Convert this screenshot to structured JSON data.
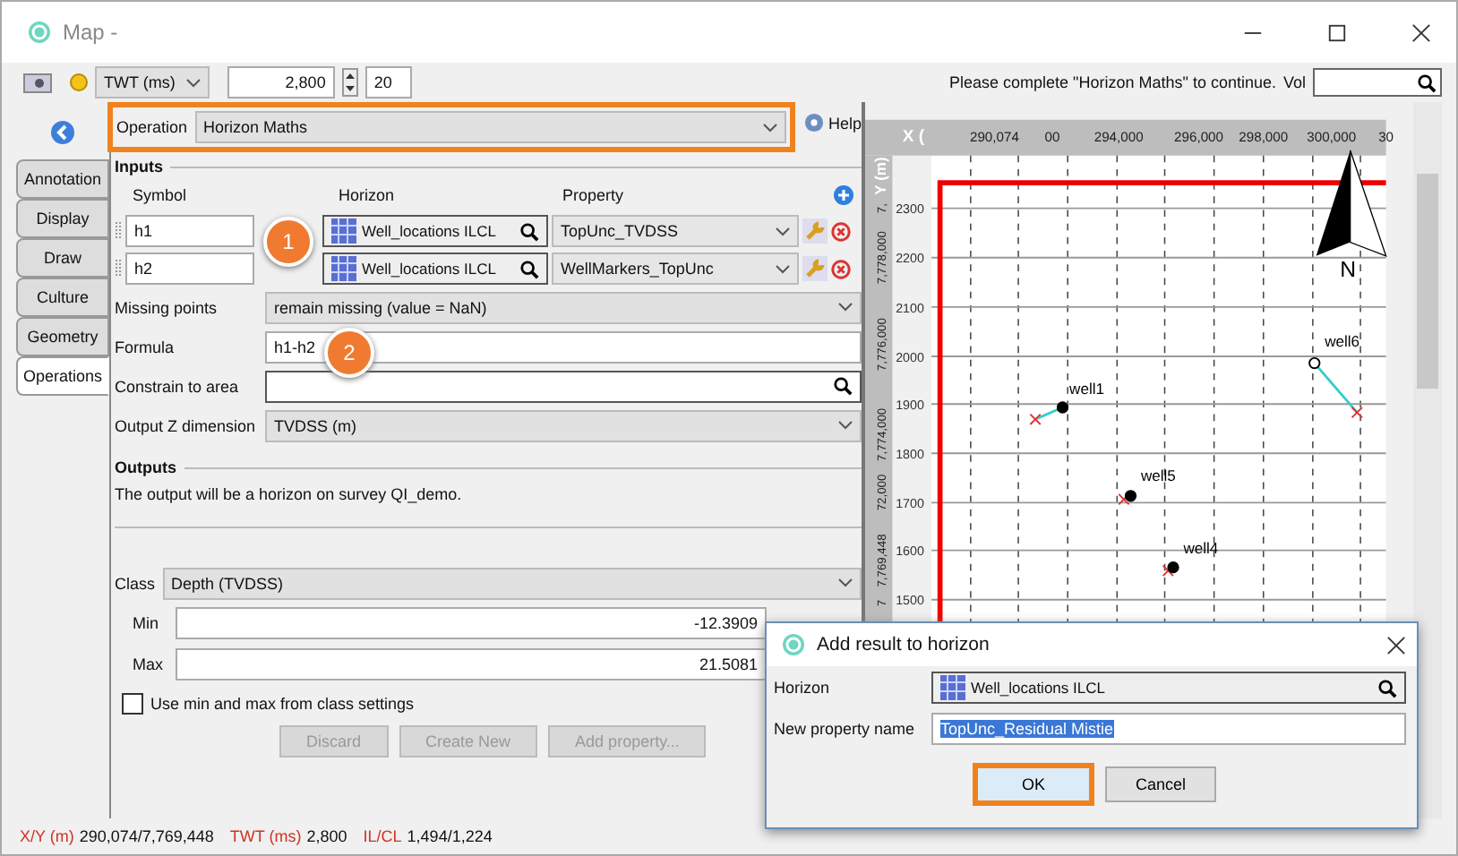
{
  "window": {
    "title": "Map -"
  },
  "toolbar": {
    "domain": "TWT (ms)",
    "value": "2,800",
    "step": "20",
    "message": "Please complete \"Horizon Maths\" to continue.",
    "vol_label": "Vol"
  },
  "side_tabs": [
    {
      "label": "Annotation",
      "selected": false
    },
    {
      "label": "Display",
      "selected": false
    },
    {
      "label": "Draw",
      "selected": false
    },
    {
      "label": "Culture",
      "selected": false
    },
    {
      "label": "Geometry",
      "selected": false
    },
    {
      "label": "Operations",
      "selected": true
    }
  ],
  "operation": {
    "label": "Operation",
    "value": "Horizon Maths",
    "help": "Help",
    "highlighted": true
  },
  "inputs": {
    "title": "Inputs",
    "headers": [
      "Symbol",
      "Horizon",
      "Property"
    ],
    "rows": [
      {
        "symbol": "h1",
        "horizon": "Well_locations ILCL",
        "property": "TopUnc_TVDSS"
      },
      {
        "symbol": "h2",
        "horizon": "Well_locations ILCL",
        "property": "WellMarkers_TopUnc"
      }
    ]
  },
  "fields": [
    {
      "label": "Missing points",
      "value": "remain missing (value = NaN)",
      "kind": "dropdown"
    },
    {
      "label": "Formula",
      "value": "h1-h2",
      "kind": "text"
    },
    {
      "label": "Constrain to area",
      "kind": "search"
    },
    {
      "label": "Output Z dimension",
      "value": "TVDSS (m)",
      "kind": "dropdown"
    }
  ],
  "outputs": {
    "title": "Outputs",
    "text": "The output will be a horizon on survey QI_demo."
  },
  "class": {
    "label": "Class",
    "value": "Depth (TVDSS)",
    "min_label": "Min",
    "min": "-12.3909",
    "max_label": "Max",
    "max": "21.5081",
    "use_class_label": "Use min and max from class settings",
    "use_class_checked": false
  },
  "actions": [
    {
      "label": "Discard",
      "disabled": true
    },
    {
      "label": "Create New",
      "disabled": true
    },
    {
      "label": "Add property...",
      "disabled": true
    }
  ],
  "callouts": [
    {
      "label": "1"
    },
    {
      "label": "2"
    }
  ],
  "map": {
    "x_axis_label": "X (",
    "x_ticks": [
      "290,074",
      "00",
      "294,000",
      "296,000",
      "298,000",
      "300,000",
      "30"
    ],
    "y_axis_label": "Y (m)",
    "y_ticks": [
      "7,",
      "7,778,000",
      "7,776,000",
      "7,774,000",
      "72,000",
      "7,769,448",
      "7"
    ],
    "contours": [
      "2300",
      "2200",
      "2100",
      "2000",
      "1900",
      "1800",
      "1700",
      "1600",
      "1500"
    ],
    "north": "N",
    "wells": [
      {
        "name": "well1"
      },
      {
        "name": "well6"
      },
      {
        "name": "well5"
      },
      {
        "name": "well4"
      }
    ]
  },
  "dialog": {
    "title": "Add result to horizon",
    "horizon_label": "Horizon",
    "horizon": "Well_locations ILCL",
    "name_label": "New property name",
    "name": "TopUnc_Residual Mistie",
    "buttons": [
      {
        "label": "OK",
        "highlighted": true
      },
      {
        "label": "Cancel",
        "highlighted": false
      }
    ]
  },
  "status_bar": [
    {
      "key": "X/Y (m)",
      "value": "290,074/7,769,448"
    },
    {
      "key": "TWT (ms)",
      "value": "2,800"
    },
    {
      "key": "IL/CL",
      "value": "1,494/1,224"
    }
  ]
}
